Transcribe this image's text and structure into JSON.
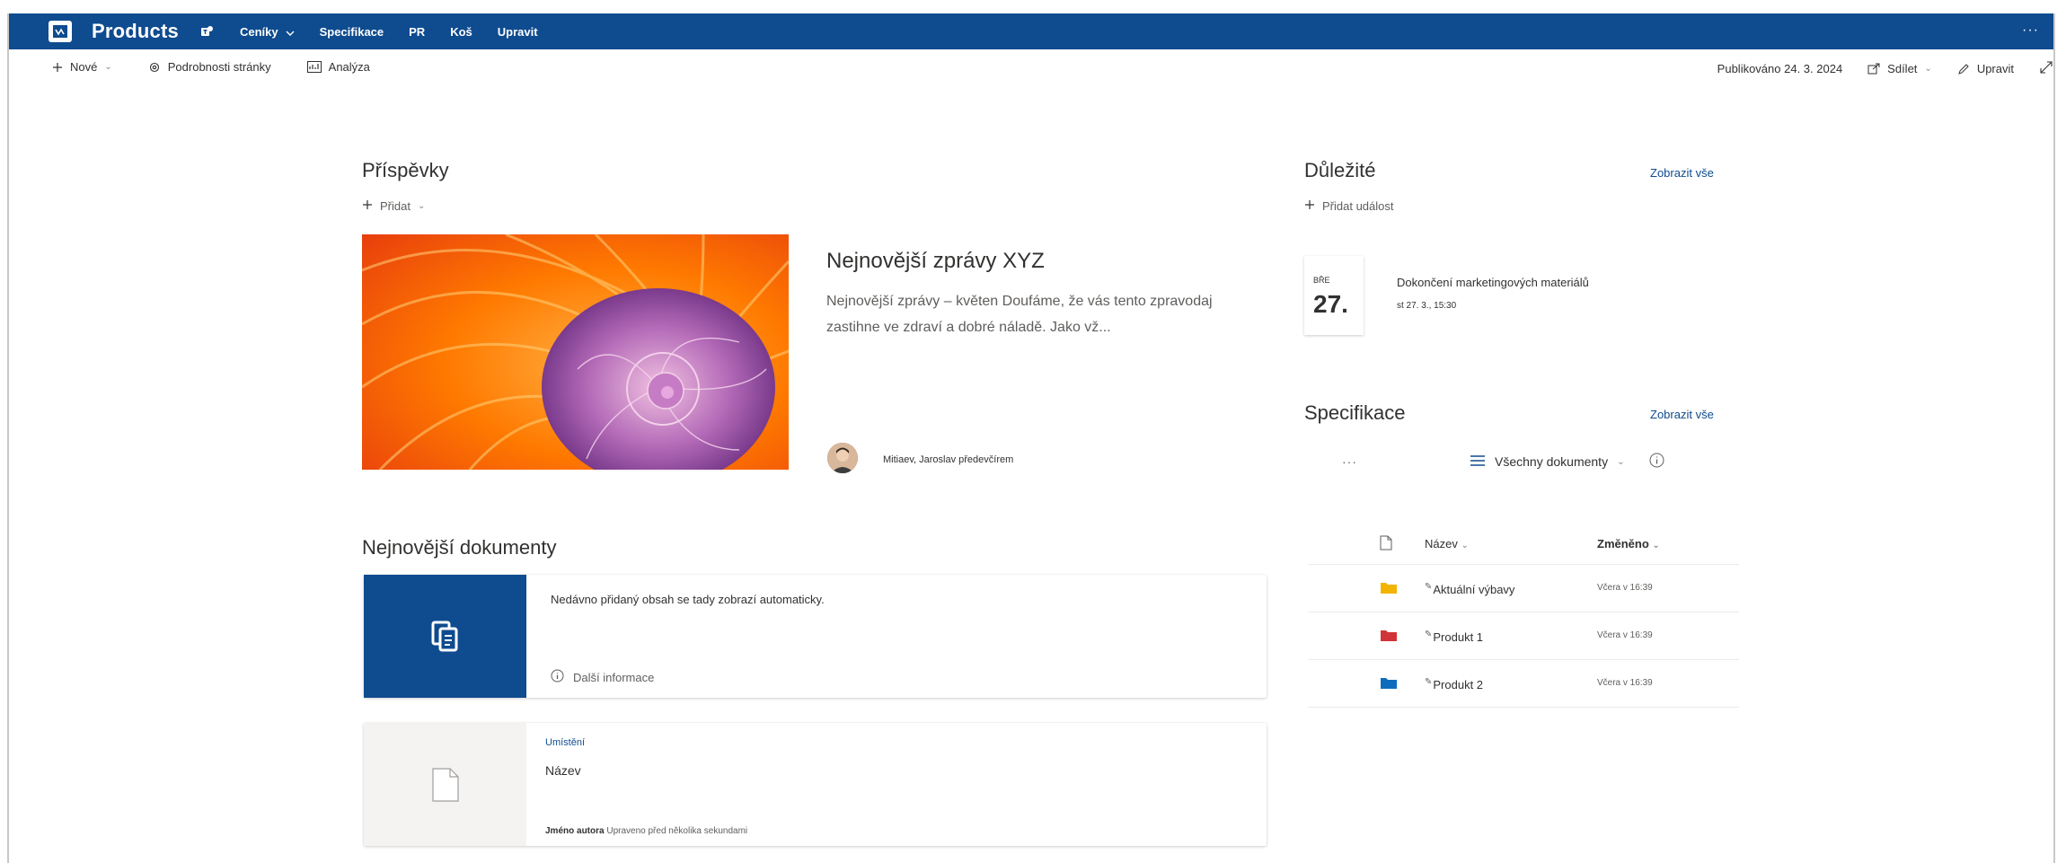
{
  "suitebar": {
    "site_title": "Products",
    "nav": [
      {
        "label": "Ceníky",
        "has_dropdown": true
      },
      {
        "label": "Specifikace"
      },
      {
        "label": "PR"
      },
      {
        "label": "Koš"
      },
      {
        "label": "Upravit"
      }
    ],
    "more_label": "···",
    "bg_color": "#0f4b8f"
  },
  "commandbar": {
    "new_label": "Nové",
    "page_details_label": "Podrobnosti stránky",
    "analytics_label": "Analýza",
    "published": "Publikováno 24. 3. 2024",
    "share_label": "Sdílet",
    "edit_label": "Upravit"
  },
  "news": {
    "heading": "Příspěvky",
    "add_label": "Přidat",
    "title": "Nejnovější zprávy XYZ",
    "excerpt": "Nejnovější zprávy – květen Doufáme, že vás tento zpravodaj zastihne ve zdraví a dobré náladě. Jako vž...",
    "author": "Mitiaev, Jaroslav předevčírem"
  },
  "recent_docs": {
    "heading": "Nejnovější dokumenty",
    "card1_text": "Nedávno přidaný obsah se tady zobrazí automaticky.",
    "card1_info": "Další informace",
    "card2_location": "Umístění",
    "card2_name": "Název",
    "card2_author": "Jméno autora",
    "card2_modified": "Upraveno před několika sekundami"
  },
  "events": {
    "heading": "Důležité",
    "see_all": "Zobrazit vše",
    "add_label": "Přidat událost",
    "date_month": "BŘE",
    "date_day": "27.",
    "event_title": "Dokončení marketingových materiálů",
    "event_time": "st 27. 3., 15:30"
  },
  "library": {
    "heading": "Specifikace",
    "see_all": "Zobrazit vše",
    "dots": "···",
    "view_label": "Všechny dokumenty",
    "col_name": "Název",
    "col_modified": "Změněno",
    "rows": [
      {
        "name": "Aktuální výbavy",
        "modified": "Včera v 16:39",
        "folder_color": "#f2b400"
      },
      {
        "name": "Produkt 1",
        "modified": "Včera v 16:39",
        "folder_color": "#d13438"
      },
      {
        "name": "Produkt 2",
        "modified": "Včera v 16:39",
        "folder_color": "#0f6cbd"
      }
    ]
  }
}
